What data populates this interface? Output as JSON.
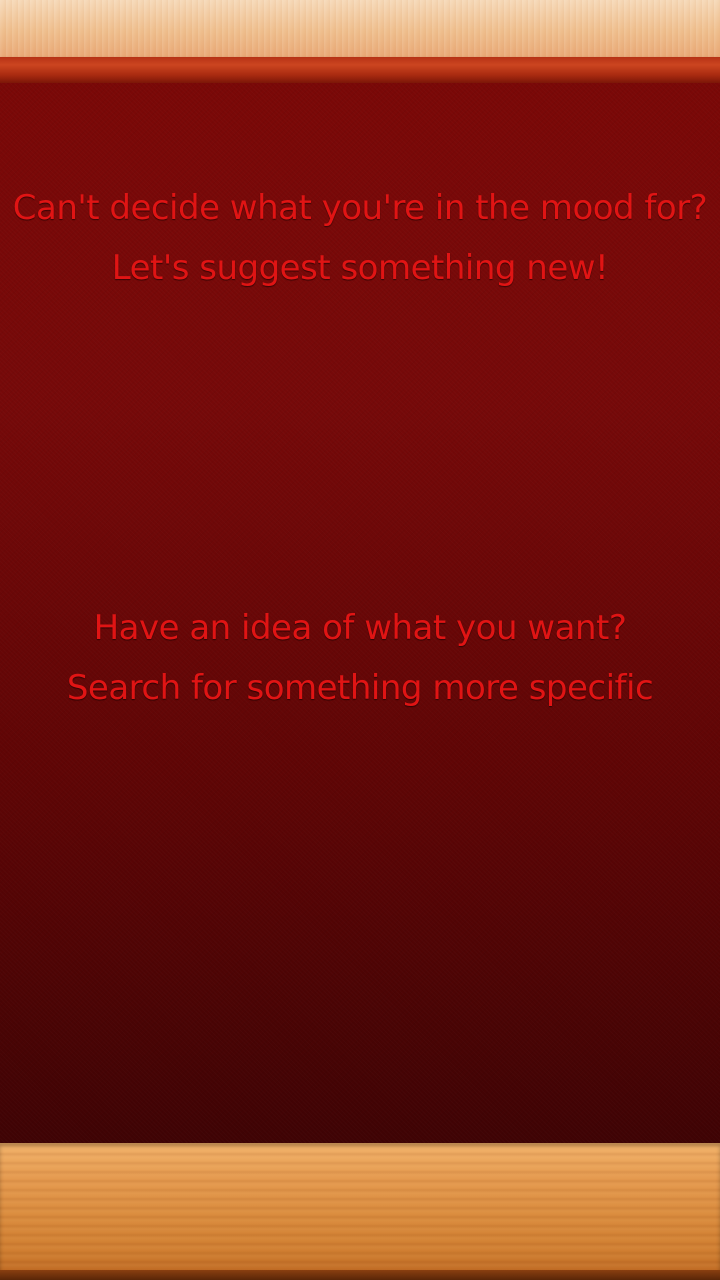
{
  "prompts": {
    "suggest": {
      "line1": "Can't decide what you're in the mood for?",
      "line2": "Let's suggest something new!"
    },
    "search": {
      "line1": "Have an idea of what you want?",
      "line2": "Search for something more specific"
    }
  },
  "colors": {
    "prompt_text": "#e01414",
    "board_top": "#7a0807",
    "board_bottom": "#3f0304",
    "trim": "#b63215",
    "shelf_wood": "#d98a3c"
  }
}
